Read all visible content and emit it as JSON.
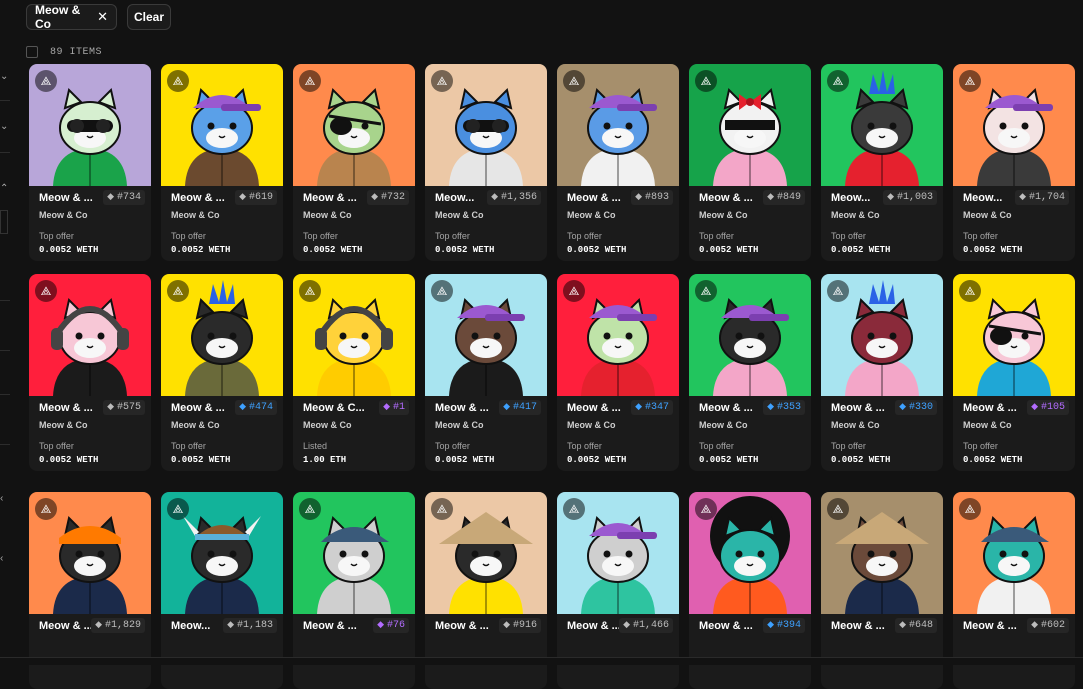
{
  "filters": {
    "chip_label": "Meow & Co",
    "chip_close": "✕",
    "clear_label": "Clear"
  },
  "items_count": "89 ITEMS",
  "badge_icon": "sparkle-badge",
  "cards": [
    {
      "name": "Meow & ...",
      "number": "#734",
      "tier": "gray",
      "collection": "Meow & Co",
      "price_label": "Top offer",
      "price": "0.0052 WETH",
      "bg": "#b8a6d9",
      "body": "#1aa34a",
      "head": "#d6efd0",
      "accessory": "sunglasses"
    },
    {
      "name": "Meow & ...",
      "number": "#619",
      "tier": "gray",
      "collection": "Meow & Co",
      "price_label": "Top offer",
      "price": "0.0052 WETH",
      "bg": "#ffe100",
      "body": "#6b4a2f",
      "head": "#5aa0e8",
      "accessory": "cap"
    },
    {
      "name": "Meow & ...",
      "number": "#732",
      "tier": "gray",
      "collection": "Meow & Co",
      "price_label": "Top offer",
      "price": "0.0052 WETH",
      "bg": "#ff8a4c",
      "body": "#b9844e",
      "head": "#a8d48c",
      "accessory": "eyepatch"
    },
    {
      "name": "Meow...",
      "number": "#1,356",
      "tier": "gray",
      "collection": "Meow & Co",
      "price_label": "Top offer",
      "price": "0.0052 WETH",
      "bg": "#ecc8a6",
      "body": "#e6e6e6",
      "head": "#4a8fe0",
      "accessory": "sunglasses"
    },
    {
      "name": "Meow & ...",
      "number": "#893",
      "tier": "gray",
      "collection": "Meow & Co",
      "price_label": "Top offer",
      "price": "0.0052 WETH",
      "bg": "#a68f6c",
      "body": "#f1f1f1",
      "head": "#5a9be6",
      "accessory": "cap"
    },
    {
      "name": "Meow & ...",
      "number": "#849",
      "tier": "gray",
      "collection": "Meow & Co",
      "price_label": "Top offer",
      "price": "0.0052 WETH",
      "bg": "#16a34a",
      "body": "#f3a6c8",
      "head": "#f2f2f2",
      "accessory": "bow"
    },
    {
      "name": "Meow...",
      "number": "#1,003",
      "tier": "gray",
      "collection": "Meow & Co",
      "price_label": "Top offer",
      "price": "0.0052 WETH",
      "bg": "#22c55e",
      "body": "#e5212e",
      "head": "#3a3a3a",
      "accessory": "mohawk"
    },
    {
      "name": "Meow...",
      "number": "#1,704",
      "tier": "gray",
      "collection": "Meow & Co",
      "price_label": "Top offer",
      "price": "0.0052 WETH",
      "bg": "#ff8a4c",
      "body": "#3a3a3a",
      "head": "#f3e3e3",
      "accessory": "cap"
    },
    {
      "name": "Meow & ...",
      "number": "#575",
      "tier": "gray",
      "collection": "Meow & Co",
      "price_label": "Top offer",
      "price": "0.0052 WETH",
      "bg": "#ff1f3c",
      "body": "#1b1b1b",
      "head": "#f7c7d6",
      "accessory": "headphones"
    },
    {
      "name": "Meow & ...",
      "number": "#474",
      "tier": "blue",
      "collection": "Meow & Co",
      "price_label": "Top offer",
      "price": "0.0052 WETH",
      "bg": "#ffe100",
      "body": "#6a6a3a",
      "head": "#2a2a2a",
      "accessory": "mohawk"
    },
    {
      "name": "Meow & C...",
      "number": "#1",
      "tier": "purple",
      "collection": "Meow & Co",
      "price_label": "Listed",
      "price": "1.00 ETH",
      "bg": "#ffe100",
      "body": "#ffcc00",
      "head": "#ffd23a",
      "accessory": "headphones"
    },
    {
      "name": "Meow & ...",
      "number": "#417",
      "tier": "blue",
      "collection": "Meow & Co",
      "price_label": "Top offer",
      "price": "0.0052 WETH",
      "bg": "#a8e4f0",
      "body": "#1b1b1b",
      "head": "#6b4a3a",
      "accessory": "cap"
    },
    {
      "name": "Meow & ...",
      "number": "#347",
      "tier": "blue",
      "collection": "Meow & Co",
      "price_label": "Top offer",
      "price": "0.0052 WETH",
      "bg": "#ff1f3c",
      "body": "#e5212e",
      "head": "#bfe3a8",
      "accessory": "cap"
    },
    {
      "name": "Meow & ...",
      "number": "#353",
      "tier": "blue",
      "collection": "Meow & Co",
      "price_label": "Top offer",
      "price": "0.0052 WETH",
      "bg": "#22c55e",
      "body": "#f3a6c8",
      "head": "#2a2a2a",
      "accessory": "cap"
    },
    {
      "name": "Meow & ...",
      "number": "#330",
      "tier": "blue",
      "collection": "Meow & Co",
      "price_label": "Top offer",
      "price": "0.0052 WETH",
      "bg": "#a8e4f0",
      "body": "#f3a6c8",
      "head": "#8a2a3a",
      "accessory": "mohawk"
    },
    {
      "name": "Meow & ...",
      "number": "#105",
      "tier": "purple",
      "collection": "Meow & Co",
      "price_label": "Top offer",
      "price": "0.0052 WETH",
      "bg": "#ffe100",
      "body": "#1fa7d6",
      "head": "#f7c7d6",
      "accessory": "eyepatch"
    },
    {
      "name": "Meow & ...",
      "number": "#1,829",
      "tier": "gray",
      "collection": "",
      "price_label": "",
      "price": "",
      "bg": "#ff8a4c",
      "body": "#1b2a4a",
      "head": "#2a2a2a",
      "accessory": "bandana"
    },
    {
      "name": "Meow...",
      "number": "#1,183",
      "tier": "gray",
      "collection": "",
      "price_label": "",
      "price": "",
      "bg": "#12b39a",
      "body": "#1b2a4a",
      "head": "#2a2a2a",
      "accessory": "viking"
    },
    {
      "name": "Meow & ...",
      "number": "#76",
      "tier": "purple",
      "collection": "",
      "price_label": "",
      "price": "",
      "bg": "#22c55e",
      "body": "#cfcfcf",
      "head": "#cfcfcf",
      "accessory": "flatcap"
    },
    {
      "name": "Meow & ...",
      "number": "#916",
      "tier": "gray",
      "collection": "",
      "price_label": "",
      "price": "",
      "bg": "#ecc8a6",
      "body": "#ffe100",
      "head": "#2a2a2a",
      "accessory": "conehat"
    },
    {
      "name": "Meow & ...",
      "number": "#1,466",
      "tier": "gray",
      "collection": "",
      "price_label": "",
      "price": "",
      "bg": "#a8e4f0",
      "body": "#2ec4a0",
      "head": "#cfcfcf",
      "accessory": "cap"
    },
    {
      "name": "Meow & ...",
      "number": "#394",
      "tier": "blue",
      "collection": "",
      "price_label": "",
      "price": "",
      "bg": "#e060b0",
      "body": "#ff5a1f",
      "head": "#2ab5a8",
      "accessory": "afro"
    },
    {
      "name": "Meow & ...",
      "number": "#648",
      "tier": "gray",
      "collection": "",
      "price_label": "",
      "price": "",
      "bg": "#a68f6c",
      "body": "#1b2a4a",
      "head": "#6b4a3a",
      "accessory": "conehat"
    },
    {
      "name": "Meow & ...",
      "number": "#602",
      "tier": "gray",
      "collection": "",
      "price_label": "",
      "price": "",
      "bg": "#ff8a4c",
      "body": "#f1f1f1",
      "head": "#2ab5a8",
      "accessory": "flatcap"
    }
  ]
}
